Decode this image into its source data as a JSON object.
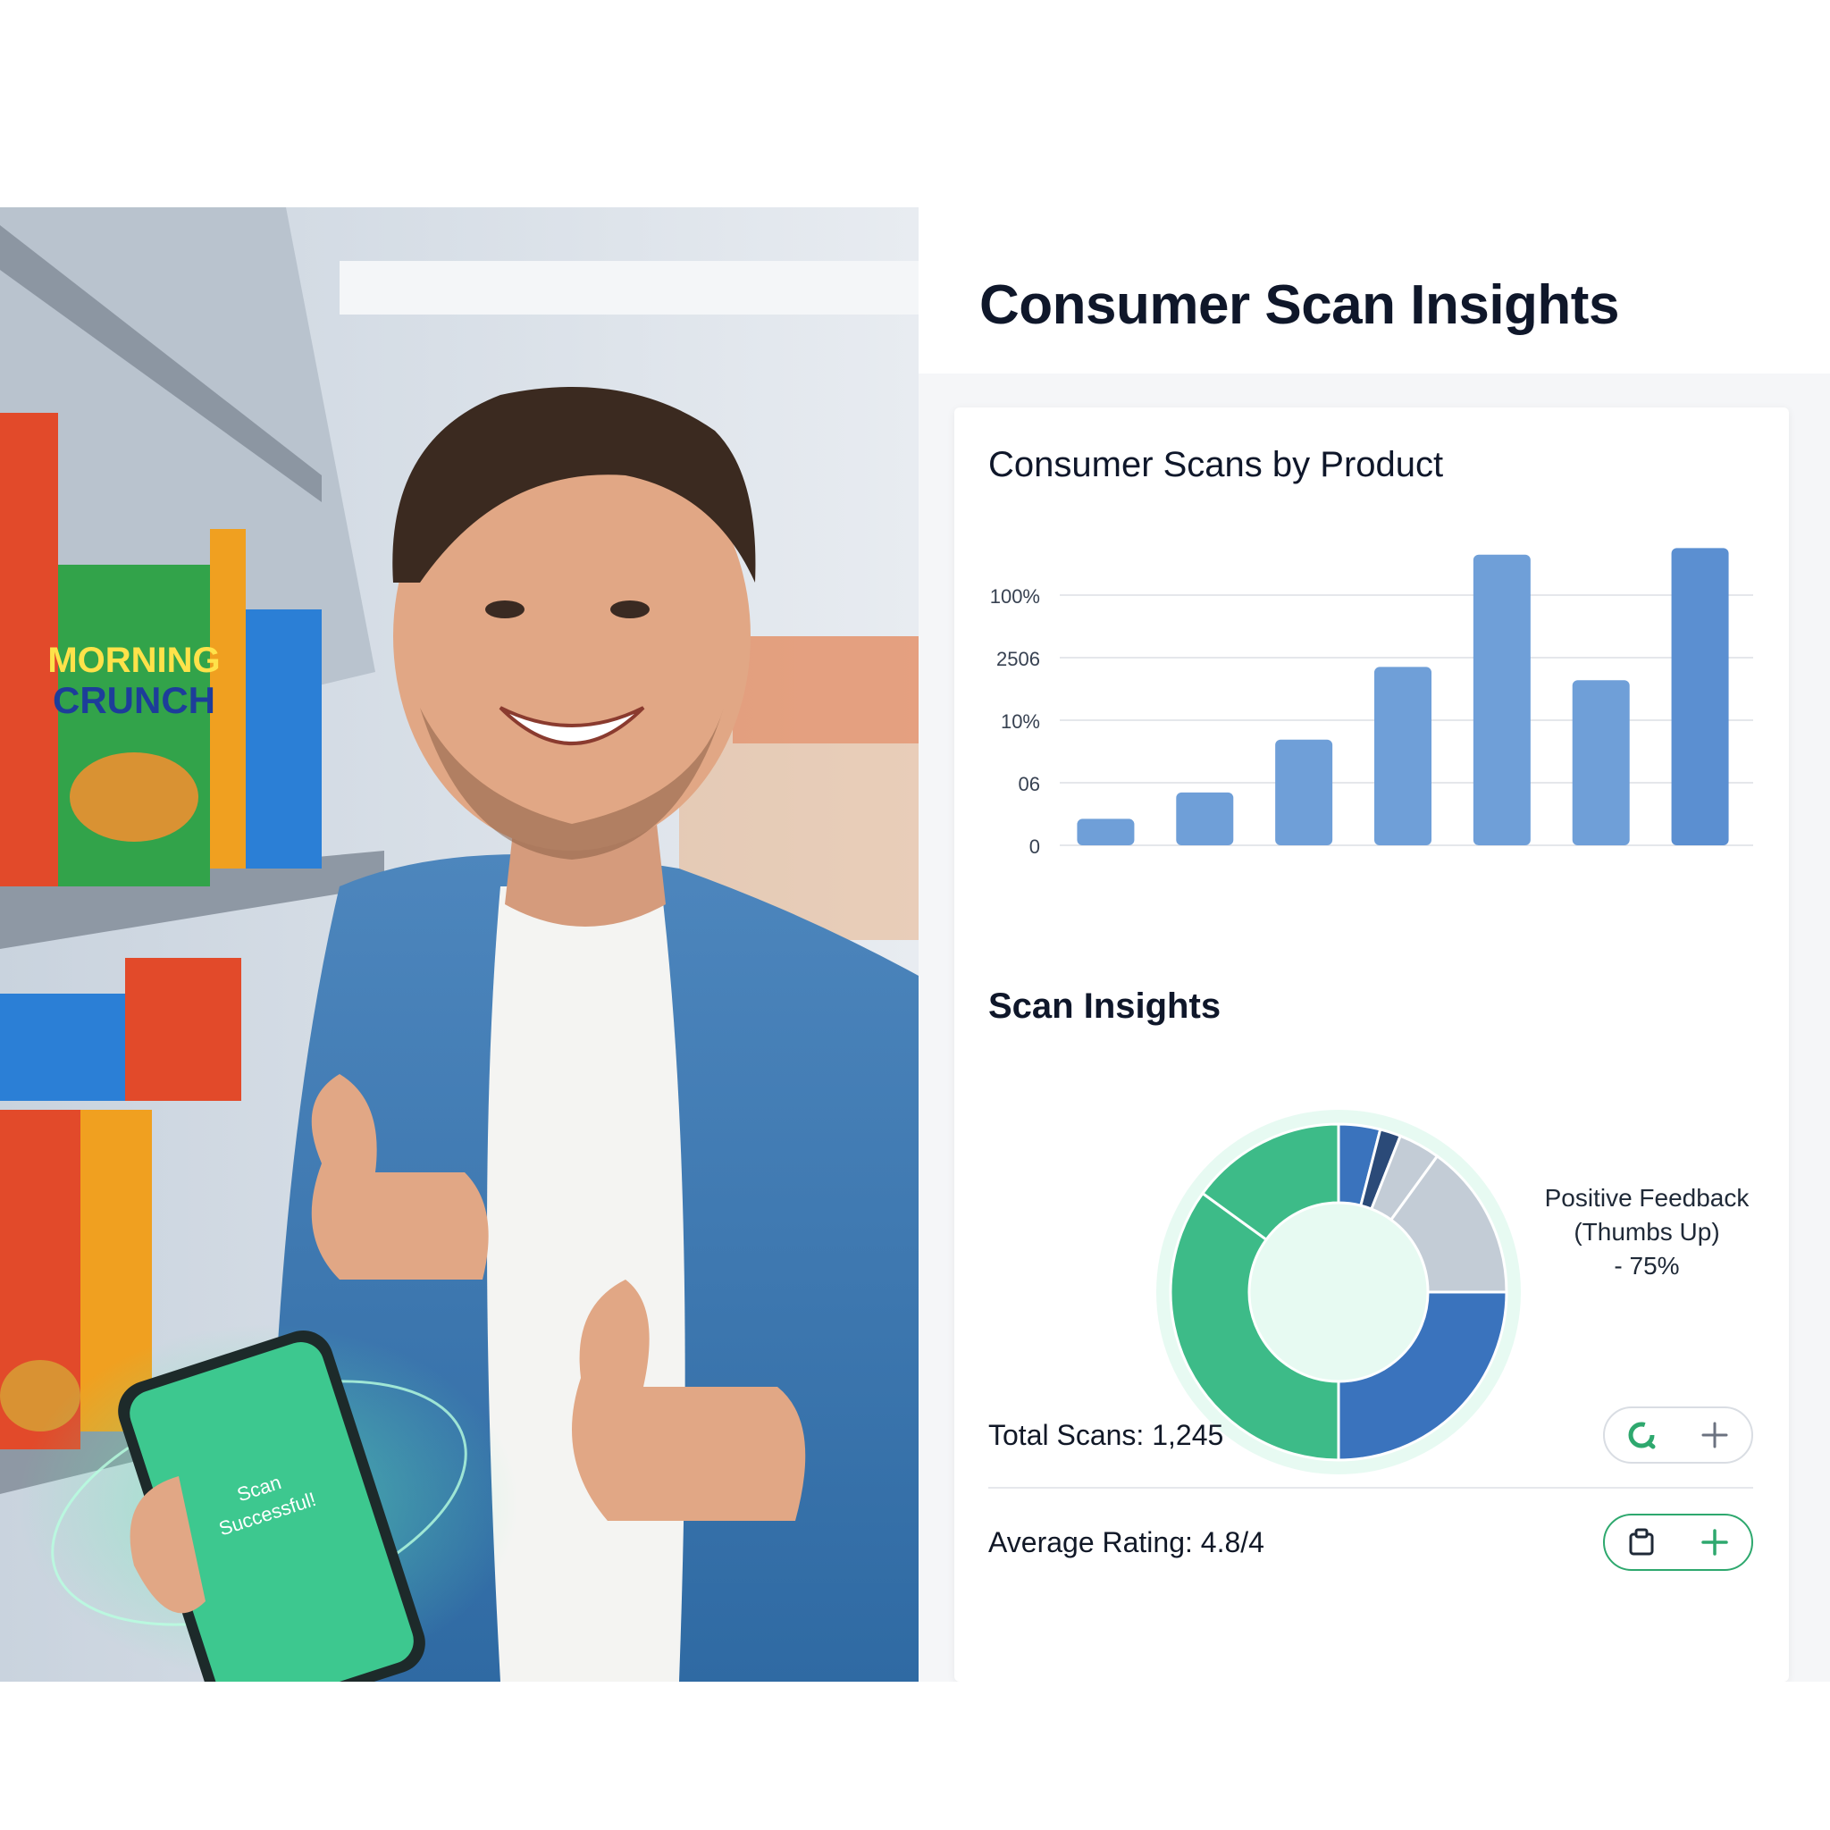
{
  "dashboard": {
    "title": "Consumer Scan Insights"
  },
  "photo": {
    "cereal_box_brand_top": "MORNING",
    "cereal_box_brand_bottom": "CRUNCH",
    "phone_screen_text": "Scan Successful!"
  },
  "bar_chart_section": {
    "title": "Consumer Scans by Product"
  },
  "donut_section": {
    "title": "Scan Insights",
    "legend_line1": "Positive Feedback",
    "legend_line2": "(Thumbs Up)",
    "legend_line3": "- 75%"
  },
  "stats": {
    "total_scans": "Total Scans: 1,245",
    "average_rating": "Average Rating: 4.8/4"
  },
  "icons": {
    "total_scans_action": "refresh-icon",
    "total_scans_add": "plus-icon",
    "rating_action": "clipboard-icon",
    "rating_add": "plus-icon"
  },
  "colors": {
    "bar": "#6f9fd8",
    "accent_green": "#2ea86e",
    "donut_green": "#3dbb88",
    "donut_blue": "#3a73bd",
    "donut_navy": "#2b4a78",
    "donut_gray": "#c3ccd6",
    "donut_light_gray": "#d6dce3"
  },
  "chart_data": {
    "type": "bar",
    "title": "Consumer Scans by Product",
    "xlabel": "",
    "ylabel": "",
    "ytick_labels": [
      "0",
      "06",
      "10%",
      "2506",
      "100%"
    ],
    "categories": [
      "",
      "",
      "",
      "",
      "",
      "",
      ""
    ],
    "values": [
      0.4,
      0.8,
      1.6,
      2.7,
      4.4,
      2.5,
      4.5
    ],
    "ylim": [
      0,
      4.6
    ],
    "grid": true
  },
  "donut_data": {
    "type": "pie",
    "title": "Scan Insights",
    "slices": [
      {
        "value": 4,
        "color": "#3a73bd"
      },
      {
        "value": 2,
        "color": "#2b4a78"
      },
      {
        "value": 4,
        "color": "#c3ccd6"
      },
      {
        "value": 15,
        "color": "#c3ccd6"
      },
      {
        "value": 25,
        "color": "#3a73bd"
      },
      {
        "value": 35,
        "color": "#3dbb88"
      },
      {
        "value": 15,
        "color": "#3dbb88"
      }
    ]
  }
}
